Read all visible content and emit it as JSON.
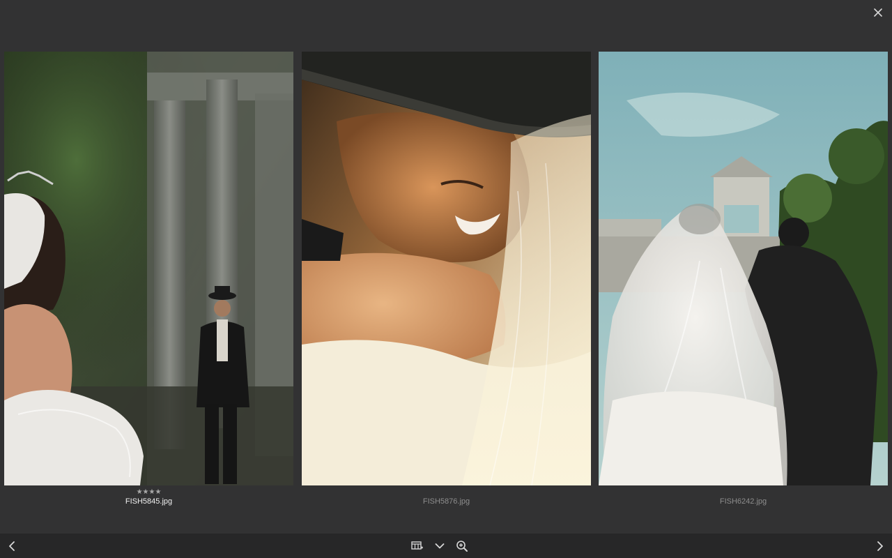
{
  "viewer": {
    "photos": [
      {
        "filename": "FISH5845.jpg",
        "rating": "★★★★",
        "selected": true
      },
      {
        "filename": "FISH5876.jpg",
        "rating": "",
        "selected": false
      },
      {
        "filename": "FISH6242.jpg",
        "rating": "",
        "selected": false
      }
    ]
  },
  "toolbar": {
    "icons": [
      "close-icon",
      "chevron-left-icon",
      "compare-grid-icon",
      "chevron-down-icon",
      "zoom-in-icon",
      "chevron-right-icon"
    ]
  },
  "colors": {
    "background": "#323233",
    "bar": "#272728",
    "icon": "#d8d8d8",
    "caption_active": "#f2f2f2",
    "caption": "#8e8e8e"
  }
}
